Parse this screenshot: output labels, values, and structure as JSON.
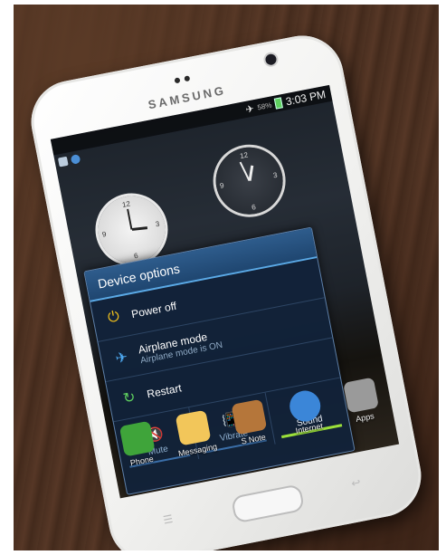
{
  "phone": {
    "brand": "SAMSUNG"
  },
  "status_bar": {
    "battery_percent": "58%",
    "time": "3:03 PM",
    "icons": [
      "airplane-icon",
      "battery-icon"
    ]
  },
  "clocks": [
    {
      "numbers": [
        "12",
        "3",
        "6",
        "9"
      ]
    },
    {
      "numbers": [
        "12",
        "3",
        "6",
        "9"
      ]
    }
  ],
  "dialog": {
    "title": "Device options",
    "options": [
      {
        "label": "Power off",
        "sublabel": "",
        "icon": "power-icon"
      },
      {
        "label": "Airplane mode",
        "sublabel": "Airplane mode is ON",
        "icon": "airplane-icon"
      },
      {
        "label": "Restart",
        "sublabel": "",
        "icon": "restart-icon"
      }
    ],
    "sound_modes": [
      {
        "label": "Mute",
        "icon": "mute-icon",
        "active": false
      },
      {
        "label": "Vibrate",
        "icon": "vibrate-icon",
        "active": false
      },
      {
        "label": "Sound",
        "icon": "sound-icon",
        "active": true
      }
    ]
  },
  "dock": [
    {
      "label": "Phone",
      "icon": "phone-icon",
      "color": "#3fa43a"
    },
    {
      "label": "Messaging",
      "icon": "messaging-icon",
      "color": "#f2c65a"
    },
    {
      "label": "S Note",
      "icon": "s-note-icon",
      "color": "#b5763a"
    },
    {
      "label": "Internet",
      "icon": "internet-icon",
      "color": "#3b86d8"
    },
    {
      "label": "Apps",
      "icon": "apps-grid-icon",
      "color": "#9a9a9a"
    }
  ],
  "colors": {
    "accent": "#5aa9e6",
    "active_mode": "#9be03a",
    "power": "#f3c21c",
    "restart": "#5fd05f"
  }
}
